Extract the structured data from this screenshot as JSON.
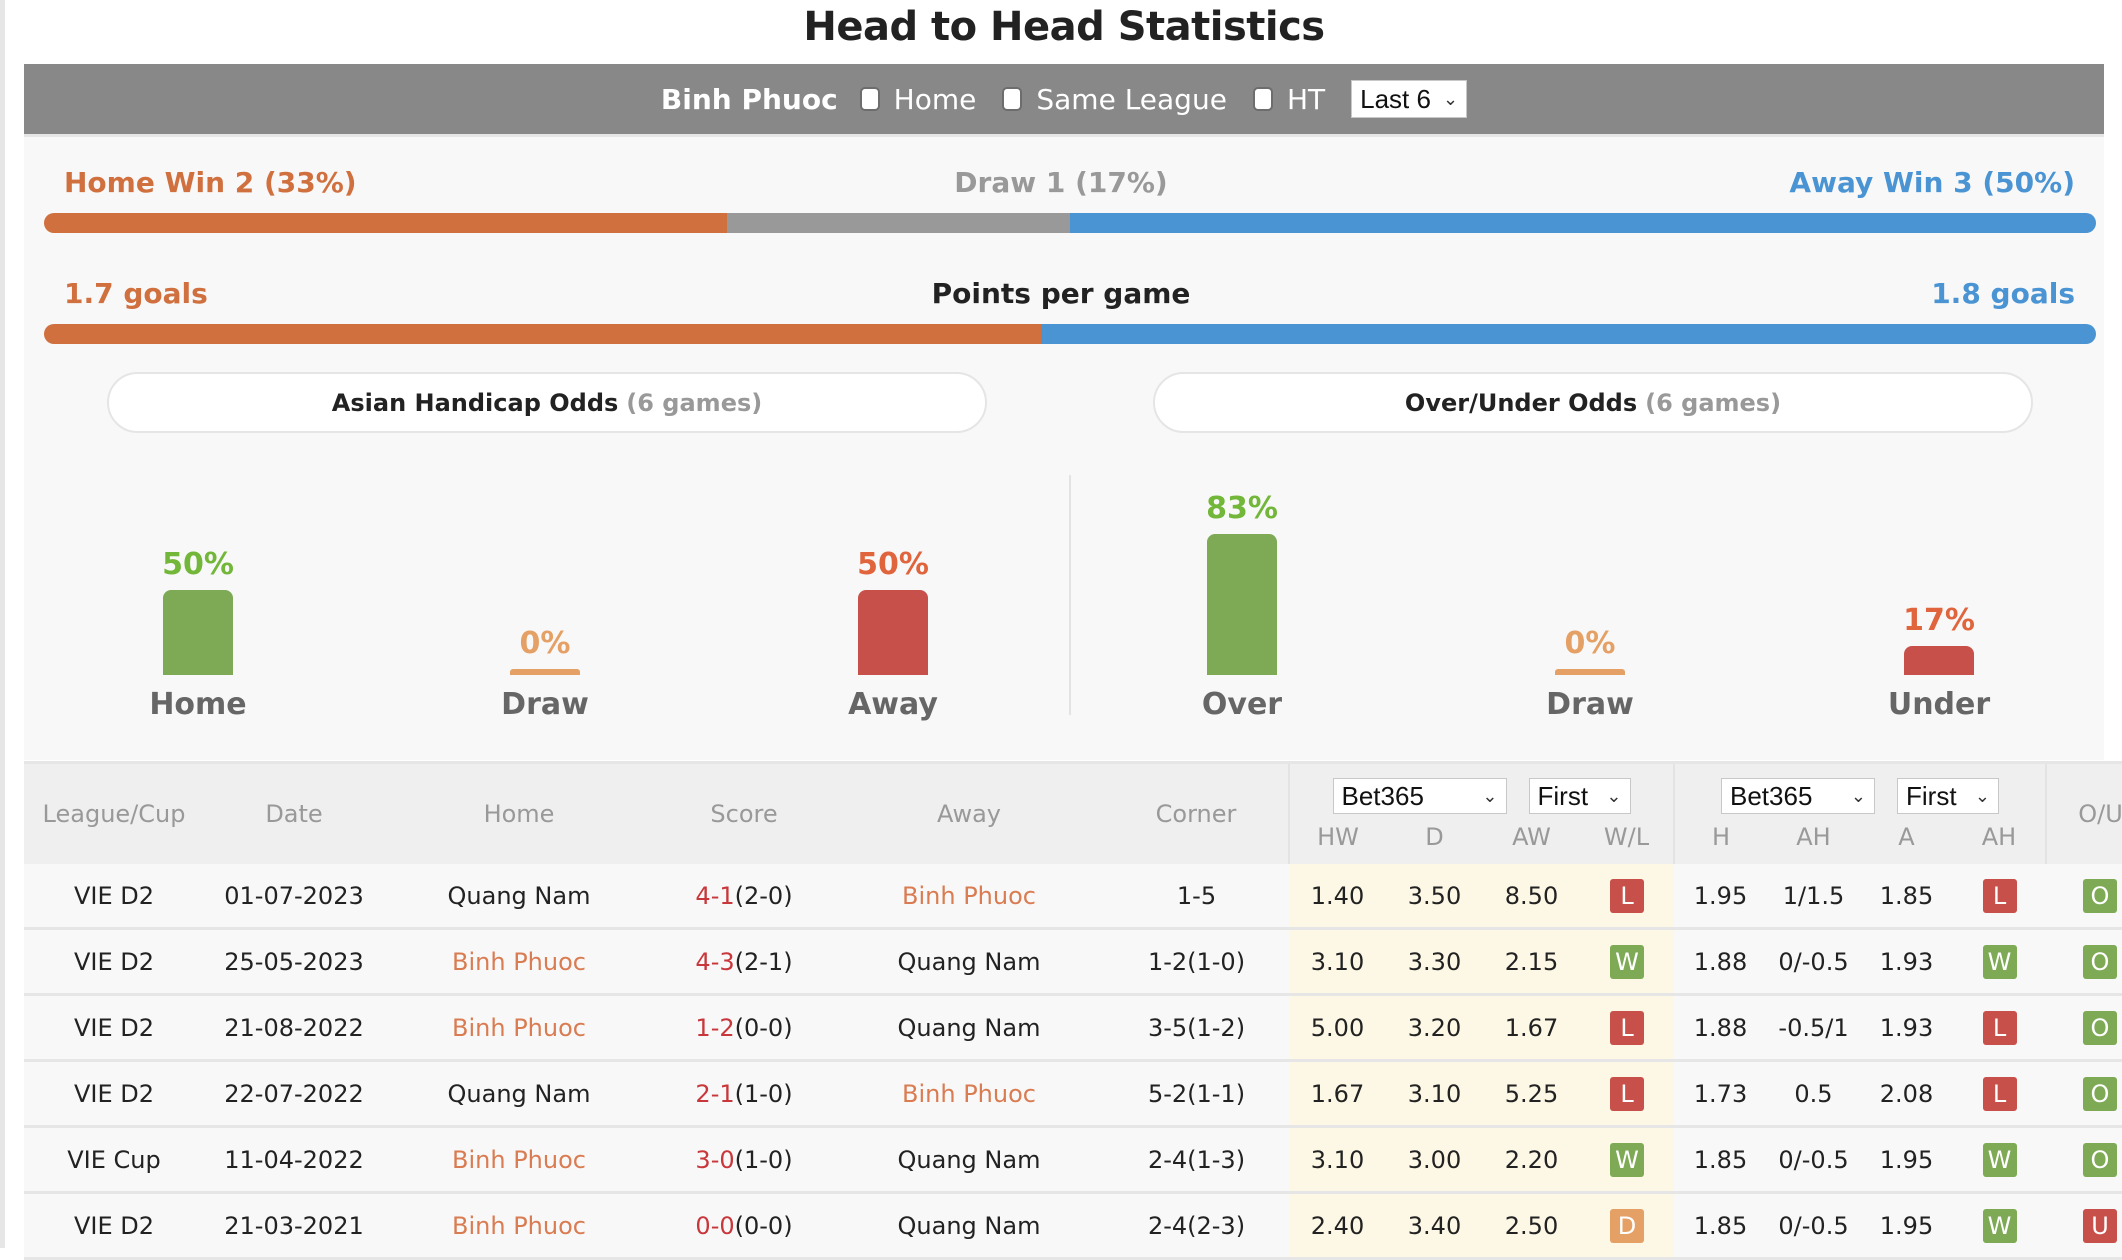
{
  "title": "Head to Head Statistics",
  "filters": {
    "team": "Binh Phuoc",
    "checkboxes": [
      {
        "label": "Home",
        "checked": false
      },
      {
        "label": "Same League",
        "checked": false
      },
      {
        "label": "HT",
        "checked": false
      }
    ],
    "range_select": "Last 6"
  },
  "colors": {
    "home": "#d0703f",
    "draw": "#999999",
    "away": "#4a94d4",
    "bar_green": "#7eaa55",
    "bar_red": "#c8504a",
    "bar_orange": "#e5a065",
    "pct_green": "#72b63a",
    "pct_red": "#e0643c",
    "pct_orange": "#e5a065",
    "badge_win": "#7eaa55",
    "badge_loss": "#c8504a",
    "badge_draw": "#e5a065"
  },
  "results": {
    "home_label": "Home Win 2 (33%)",
    "draw_label": "Draw 1 (17%)",
    "away_label": "Away Win 3 (50%)",
    "home_pct": 33.3,
    "draw_pct": 16.7,
    "away_pct": 50
  },
  "goals": {
    "home_label": "1.7 goals",
    "center_label": "Points per game",
    "away_label": "1.8 goals",
    "home_value": 1.7,
    "away_value": 1.8
  },
  "asian_handicap": {
    "title": "Asian Handicap Odds",
    "subtitle": "(6 games)",
    "bars": [
      {
        "label": "Home",
        "pct_text": "50%",
        "value": 50,
        "kind": "green"
      },
      {
        "label": "Draw",
        "pct_text": "0%",
        "value": 0,
        "kind": "orange"
      },
      {
        "label": "Away",
        "pct_text": "50%",
        "value": 50,
        "kind": "red"
      }
    ]
  },
  "over_under": {
    "title": "Over/Under Odds",
    "subtitle": "(6 games)",
    "bars": [
      {
        "label": "Over",
        "pct_text": "83%",
        "value": 83,
        "kind": "green"
      },
      {
        "label": "Draw",
        "pct_text": "0%",
        "value": 0,
        "kind": "orange"
      },
      {
        "label": "Under",
        "pct_text": "17%",
        "value": 17,
        "kind": "red"
      }
    ]
  },
  "table": {
    "headers": {
      "league": "League/Cup",
      "date": "Date",
      "home": "Home",
      "score": "Score",
      "away": "Away",
      "corner": "Corner",
      "ou": "O/U",
      "odds1_company": "Bet365",
      "odds1_type": "First",
      "odds2_company": "Bet365",
      "odds2_type": "First",
      "hw": "HW",
      "d": "D",
      "aw": "AW",
      "wl": "W/L",
      "h": "H",
      "ah": "AH",
      "a": "A",
      "ah2": "AH"
    },
    "rows": [
      {
        "league": "VIE D2",
        "date": "01-07-2023",
        "home": "Quang Nam",
        "home_hl": false,
        "score_ft": "4-1",
        "score_ht": "(2-0)",
        "away": "Binh Phuoc",
        "away_hl": true,
        "corner": "1-5",
        "hw": "1.40",
        "d": "3.50",
        "aw": "8.50",
        "wl": "L",
        "h": "1.95",
        "ah": "1/1.5",
        "a": "1.85",
        "ah_res": "L",
        "ou": "O"
      },
      {
        "league": "VIE D2",
        "date": "25-05-2023",
        "home": "Binh Phuoc",
        "home_hl": true,
        "score_ft": "4-3",
        "score_ht": "(2-1)",
        "away": "Quang Nam",
        "away_hl": false,
        "corner": "1-2(1-0)",
        "hw": "3.10",
        "d": "3.30",
        "aw": "2.15",
        "wl": "W",
        "h": "1.88",
        "ah": "0/-0.5",
        "a": "1.93",
        "ah_res": "W",
        "ou": "O"
      },
      {
        "league": "VIE D2",
        "date": "21-08-2022",
        "home": "Binh Phuoc",
        "home_hl": true,
        "score_ft": "1-2",
        "score_ht": "(0-0)",
        "away": "Quang Nam",
        "away_hl": false,
        "corner": "3-5(1-2)",
        "hw": "5.00",
        "d": "3.20",
        "aw": "1.67",
        "wl": "L",
        "h": "1.88",
        "ah": "-0.5/1",
        "a": "1.93",
        "ah_res": "L",
        "ou": "O"
      },
      {
        "league": "VIE D2",
        "date": "22-07-2022",
        "home": "Quang Nam",
        "home_hl": false,
        "score_ft": "2-1",
        "score_ht": "(1-0)",
        "away": "Binh Phuoc",
        "away_hl": true,
        "corner": "5-2(1-1)",
        "hw": "1.67",
        "d": "3.10",
        "aw": "5.25",
        "wl": "L",
        "h": "1.73",
        "ah": "0.5",
        "a": "2.08",
        "ah_res": "L",
        "ou": "O"
      },
      {
        "league": "VIE Cup",
        "date": "11-04-2022",
        "home": "Binh Phuoc",
        "home_hl": true,
        "score_ft": "3-0",
        "score_ht": "(1-0)",
        "away": "Quang Nam",
        "away_hl": false,
        "corner": "2-4(1-3)",
        "hw": "3.10",
        "d": "3.00",
        "aw": "2.20",
        "wl": "W",
        "h": "1.85",
        "ah": "0/-0.5",
        "a": "1.95",
        "ah_res": "W",
        "ou": "O"
      },
      {
        "league": "VIE D2",
        "date": "21-03-2021",
        "home": "Binh Phuoc",
        "home_hl": true,
        "score_ft": "0-0",
        "score_ht": "(0-0)",
        "away": "Quang Nam",
        "away_hl": false,
        "corner": "2-4(2-3)",
        "hw": "2.40",
        "d": "3.40",
        "aw": "2.50",
        "wl": "D",
        "h": "1.85",
        "ah": "0/-0.5",
        "a": "1.95",
        "ah_res": "W",
        "ou": "U"
      }
    ]
  }
}
